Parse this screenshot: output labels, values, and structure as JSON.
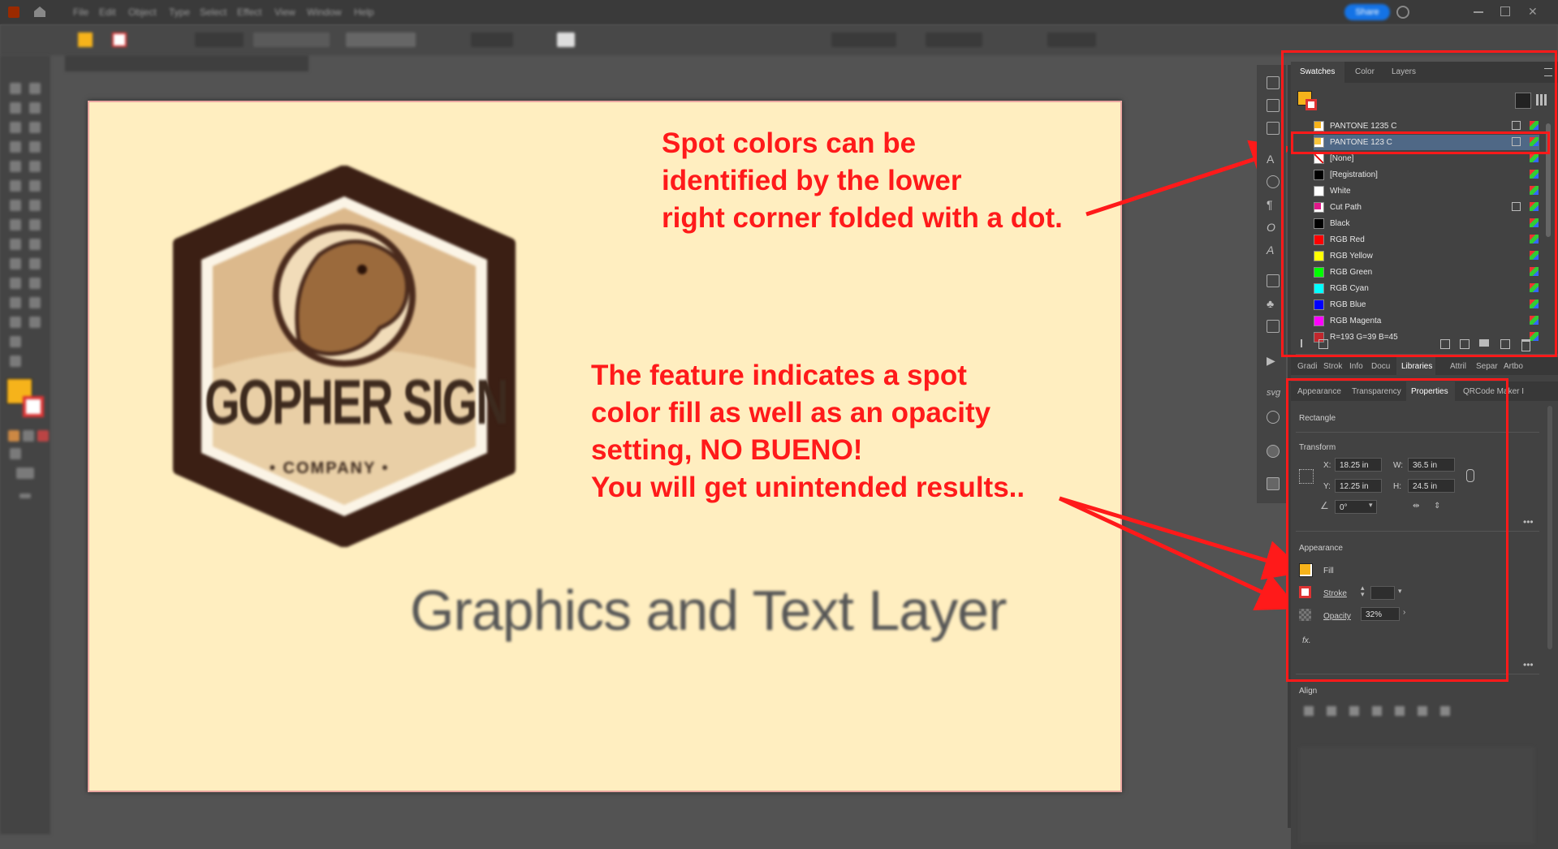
{
  "annotations": {
    "top": "Spot colors can be\nidentified by the lower\nright corner folded with a dot.",
    "bottom": "The feature indicates a spot\ncolor fill as well as an opacity\nsetting, NO BUENO!\nYou will get unintended results.."
  },
  "artwork": {
    "logo_main": "GOPHER SIGN",
    "logo_sub": "• COMPANY •",
    "caption": "Graphics and Text Layer"
  },
  "swatches_panel": {
    "tabs": [
      "Swatches",
      "Color",
      "Layers"
    ],
    "active_tab": "Swatches",
    "rows": [
      {
        "name": "PANTONE 1235 C",
        "color": "#f6b31b",
        "spot": true
      },
      {
        "name": "PANTONE 123 C",
        "color": "#f9c53c",
        "spot": true,
        "selected": true
      },
      {
        "name": "[None]",
        "color": "none"
      },
      {
        "name": "[Registration]",
        "color": "#000000"
      },
      {
        "name": "White",
        "color": "#ffffff"
      },
      {
        "name": "Cut Path",
        "color": "#e0188a",
        "spot": true
      },
      {
        "name": "Black",
        "color": "#000000"
      },
      {
        "name": "RGB Red",
        "color": "#ff0000"
      },
      {
        "name": "RGB Yellow",
        "color": "#ffff00"
      },
      {
        "name": "RGB Green",
        "color": "#00ff00"
      },
      {
        "name": "RGB Cyan",
        "color": "#00ffff"
      },
      {
        "name": "RGB Blue",
        "color": "#0000ff"
      },
      {
        "name": "RGB Magenta",
        "color": "#ff00ff"
      },
      {
        "name": "R=193 G=39 B=45",
        "color": "#c1272d"
      }
    ]
  },
  "subtabs": [
    "Gradi",
    "Strok",
    "Info",
    "Docu",
    "Libraries",
    "Attril",
    "Separ",
    "Artbo"
  ],
  "properties_tabs": [
    "Appearance",
    "Transparency",
    "Properties",
    "QRCode Maker I"
  ],
  "properties": {
    "object_type": "Rectangle",
    "transform_title": "Transform",
    "x_label": "X:",
    "x": "18.25 in",
    "y_label": "Y:",
    "y": "12.25 in",
    "w_label": "W:",
    "w": "36.5 in",
    "h_label": "H:",
    "h": "24.5 in",
    "angle": "0°",
    "appearance_title": "Appearance",
    "fill_label": "Fill",
    "fill_color": "#f6b31b",
    "stroke_label": "Stroke",
    "opacity_label": "Opacity",
    "opacity": "32%",
    "fx": "fx.",
    "align_title": "Align"
  },
  "ui": {
    "share_label": "Share",
    "accent": "#1473e6",
    "annotation_color": "#ff1a1a"
  }
}
